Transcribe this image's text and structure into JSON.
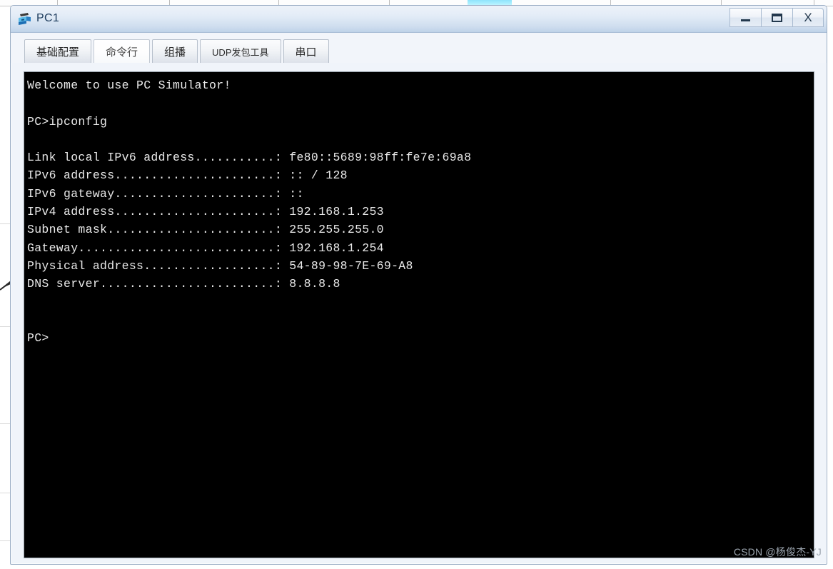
{
  "window": {
    "title": "PC1",
    "icon": "pc-device-icon",
    "buttons": {
      "minimize": "—",
      "maximize": "❐",
      "close": "X"
    }
  },
  "tabs": [
    {
      "id": "basic-config",
      "label": "基础配置",
      "selected": false
    },
    {
      "id": "command-line",
      "label": "命令行",
      "selected": true
    },
    {
      "id": "multicast",
      "label": "组播",
      "selected": false
    },
    {
      "id": "udp-tool",
      "label": "UDP发包工具",
      "selected": false
    },
    {
      "id": "serial-port",
      "label": "串口",
      "selected": false
    }
  ],
  "terminal": {
    "background": "#000000",
    "foreground": "#e9e9e9",
    "lines": [
      "Welcome to use PC Simulator!",
      "",
      "PC>ipconfig",
      "",
      "Link local IPv6 address...........: fe80::5689:98ff:fe7e:69a8",
      "IPv6 address......................: :: / 128",
      "IPv6 gateway......................: ::",
      "IPv4 address......................: 192.168.1.253",
      "Subnet mask.......................: 255.255.255.0",
      "Gateway...........................: 192.168.1.254",
      "Physical address..................: 54-89-98-7E-69-A8",
      "DNS server........................: 8.8.8.8",
      "",
      "",
      "PC>"
    ],
    "fields": [
      {
        "label": "Link local IPv6 address",
        "value": "fe80::5689:98ff:fe7e:69a8"
      },
      {
        "label": "IPv6 address",
        "value": ":: / 128"
      },
      {
        "label": "IPv6 gateway",
        "value": "::"
      },
      {
        "label": "IPv4 address",
        "value": "192.168.1.253"
      },
      {
        "label": "Subnet mask",
        "value": "255.255.255.0"
      },
      {
        "label": "Gateway",
        "value": "192.168.1.254"
      },
      {
        "label": "Physical address",
        "value": "54-89-98-7E-69-A8"
      },
      {
        "label": "DNS server",
        "value": "8.8.8.8"
      }
    ],
    "welcome": "Welcome to use PC Simulator!",
    "command": "PC>ipconfig",
    "prompt": "PC>"
  },
  "watermark": {
    "text": "CSDN @杨俊杰-YJ"
  }
}
